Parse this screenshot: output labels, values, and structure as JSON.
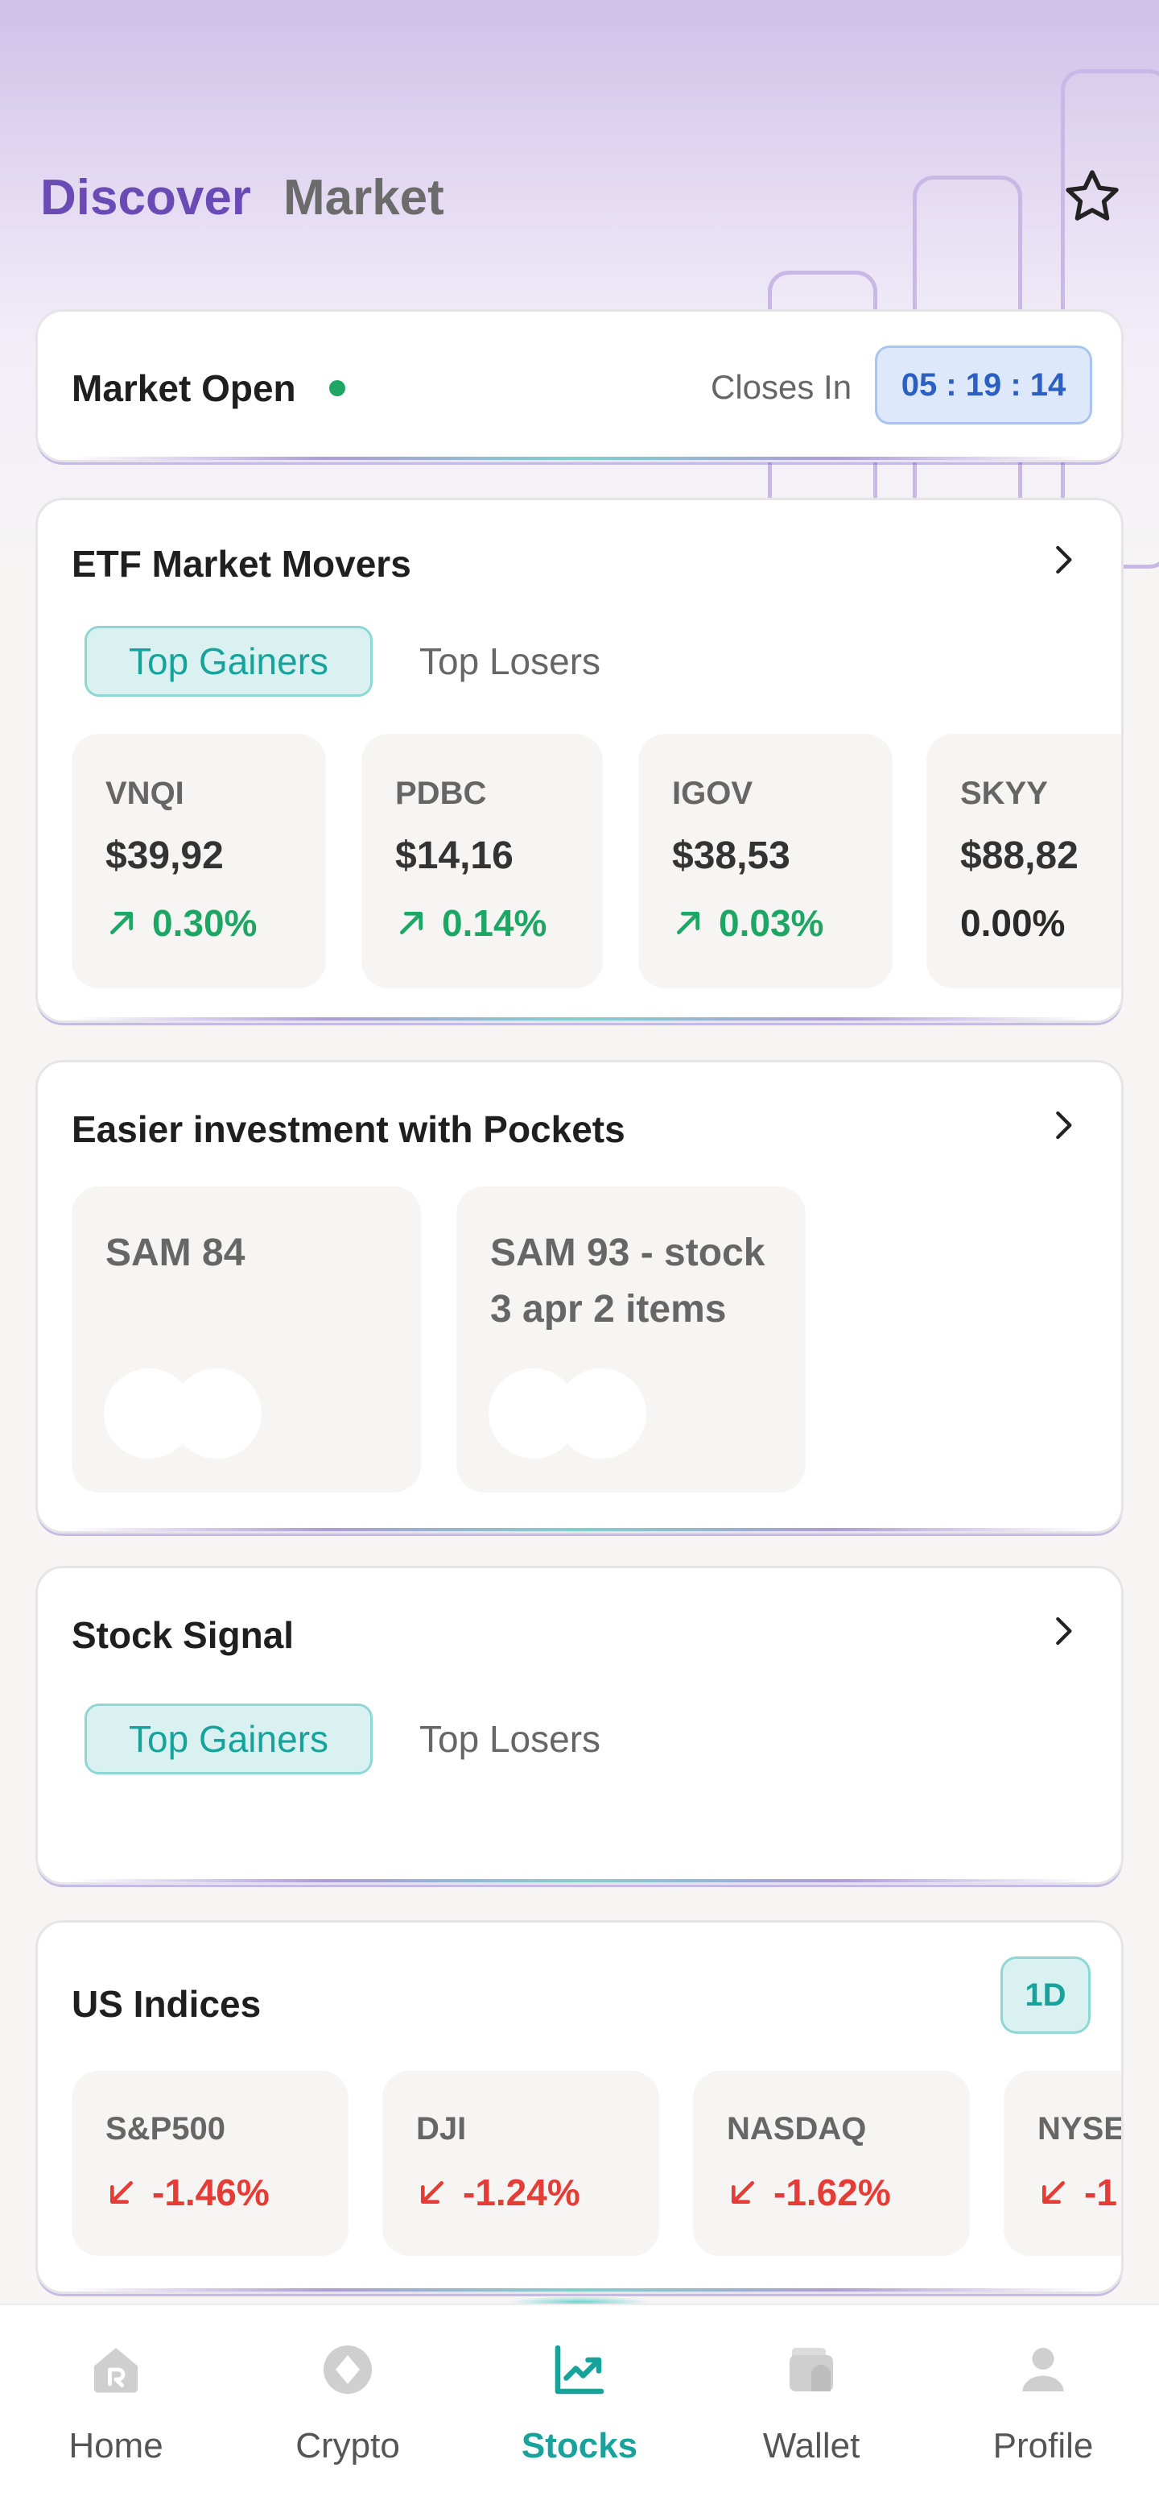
{
  "header": {
    "tabs": [
      {
        "label": "Discover",
        "active": true
      },
      {
        "label": "Market",
        "active": false
      }
    ]
  },
  "market_status": {
    "label": "Market Open",
    "closes_label": "Closes In",
    "countdown": "05 : 19 : 14"
  },
  "etf_movers": {
    "title": "ETF Market Movers",
    "filters": [
      "Top Gainers",
      "Top Losers"
    ],
    "items": [
      {
        "symbol": "VNQI",
        "price": "$39,92",
        "change": "0.30%",
        "direction": "up"
      },
      {
        "symbol": "PDBC",
        "price": "$14,16",
        "change": "0.14%",
        "direction": "up"
      },
      {
        "symbol": "IGOV",
        "price": "$38,53",
        "change": "0.03%",
        "direction": "up"
      },
      {
        "symbol": "SKYY",
        "price": "$88,82",
        "change": "0.00%",
        "direction": "flat"
      }
    ]
  },
  "pockets": {
    "title": "Easier investment with Pockets",
    "items": [
      {
        "name": "SAM 84"
      },
      {
        "name": "SAM 93 - stock 3 apr 2 items"
      }
    ]
  },
  "stock_signal": {
    "title": "Stock Signal",
    "filters": [
      "Top Gainers",
      "Top Losers"
    ]
  },
  "us_indices": {
    "title": "US Indices",
    "period": "1D",
    "items": [
      {
        "name": "S&P500",
        "change": "-1.46%",
        "direction": "down"
      },
      {
        "name": "DJI",
        "change": "-1.24%",
        "direction": "down"
      },
      {
        "name": "NASDAQ",
        "change": "-1.62%",
        "direction": "down"
      },
      {
        "name": "NYSE",
        "change": "-1",
        "direction": "down"
      }
    ]
  },
  "bottom_nav": {
    "items": [
      {
        "label": "Home",
        "icon": "home-icon",
        "active": false
      },
      {
        "label": "Crypto",
        "icon": "crypto-icon",
        "active": false
      },
      {
        "label": "Stocks",
        "icon": "stocks-chart-icon",
        "active": true
      },
      {
        "label": "Wallet",
        "icon": "wallet-icon",
        "active": false
      },
      {
        "label": "Profile",
        "icon": "profile-icon",
        "active": false
      }
    ]
  },
  "colors": {
    "accent": "#6a4bb5",
    "teal": "#17a39b",
    "gain": "#1ea764",
    "loss": "#e53c35",
    "timer_bg": "#dde9fb",
    "timer_text": "#2b5fc4"
  }
}
